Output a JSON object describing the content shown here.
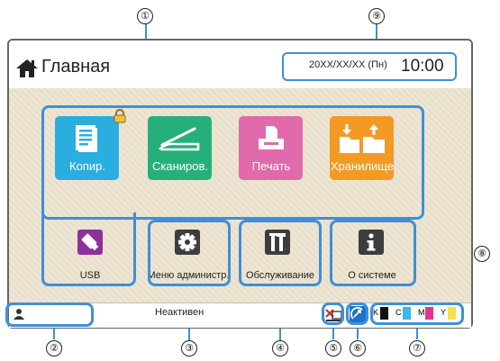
{
  "header": {
    "title": "Главная",
    "date": "20XX/XX/XX (Пн)",
    "time": "10:00"
  },
  "apps": {
    "copy": "Копир.",
    "scan": "Сканиров.",
    "print": "Печать",
    "storage": "Хранилище"
  },
  "tools": {
    "usb": "USB",
    "admin": "Меню администр.",
    "maintenance": "Обслуживание",
    "about": "О системе"
  },
  "status": {
    "text": "Неактивен",
    "ink_labels": [
      "K",
      "C",
      "M",
      "Y"
    ]
  },
  "callouts": [
    "①",
    "②",
    "③",
    "④",
    "⑤",
    "⑥",
    "⑦",
    "⑧",
    "⑨"
  ],
  "colors": {
    "accent": "#3f8fd8",
    "copy": "#2aaee0",
    "scan": "#25b07a",
    "print": "#e06aab",
    "storage": "#f39a24",
    "usb": "#8e2f9a",
    "tool": "#3d3d3d",
    "ink_k": "#111111",
    "ink_c": "#37b7ea",
    "ink_m": "#e0358f",
    "ink_y": "#f4e04a"
  },
  "icons": {
    "home": "home-icon",
    "lock": "lock-icon",
    "copy": "document-icon",
    "scan": "scanner-icon",
    "print": "printer-icon",
    "storage": "folder-icon",
    "usb": "usb-drive-icon",
    "admin": "gear-icon",
    "maintenance": "tools-icon",
    "about": "info-icon",
    "user": "user-icon",
    "error": "printer-error-icon",
    "connection": "connection-icon"
  }
}
